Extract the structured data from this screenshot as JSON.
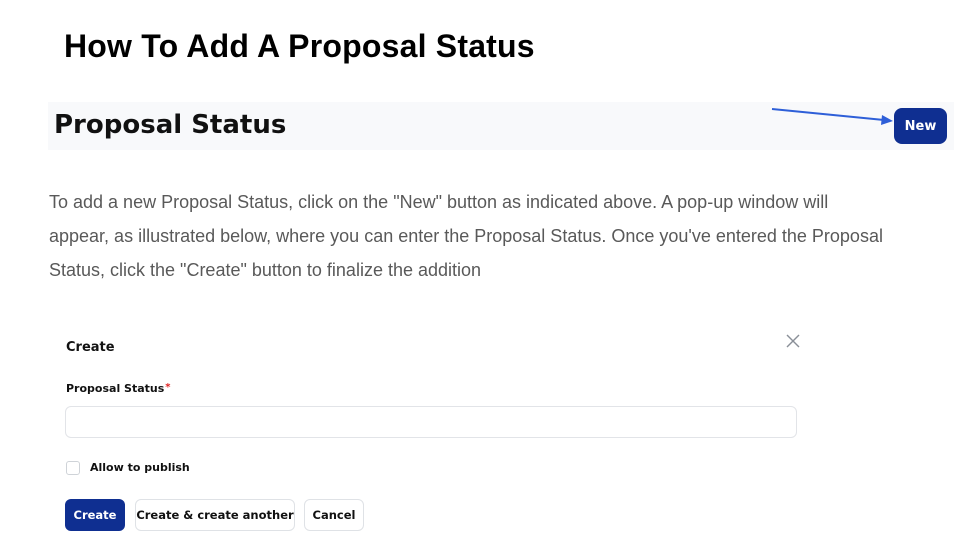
{
  "slide": {
    "title": "How To Add A Proposal Status"
  },
  "header": {
    "title": "Proposal Status",
    "new_label": "New"
  },
  "instructions": {
    "lines": [
      "To add a new Proposal Status, click on the \"New\" button as indicated above. A pop-up window will",
      "appear, as illustrated below, where you can enter the Proposal Status. Once you've entered the Proposal",
      "Status, click the \"Create\" button to finalize the addition"
    ]
  },
  "modal": {
    "title": "Create",
    "close_icon": "close-icon",
    "field_label": "Proposal Status",
    "required_mark": "*",
    "input_value": "",
    "checkbox_label": "Allow to publish",
    "checkbox_checked": false,
    "buttons": {
      "create": "Create",
      "create_another": "Create & create another",
      "cancel": "Cancel"
    }
  },
  "colors": {
    "primary": "#0f2f91",
    "arrow": "#2e5fd8",
    "required": "#e02424"
  }
}
